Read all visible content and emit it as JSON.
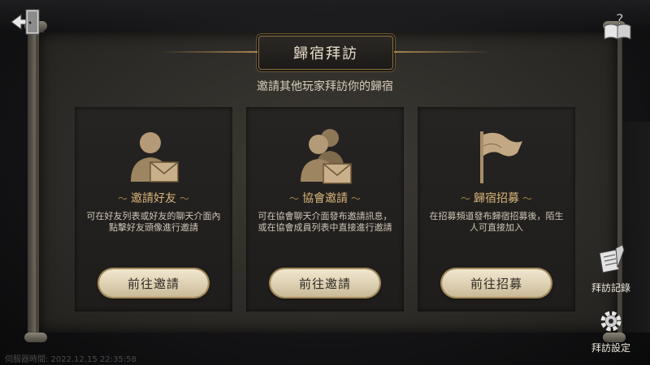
{
  "title": "歸宿拜訪",
  "subtitle": "邀請其他玩家拜訪你的歸宿",
  "cards": [
    {
      "icon": "person-letter-icon",
      "title": "邀請好友",
      "description": "可在好友列表或好友的聊天介面內點擊好友頭像進行邀請",
      "button": "前往邀請"
    },
    {
      "icon": "group-letter-icon",
      "title": "協會邀請",
      "description": "可在協會聊天介面發布邀請訊息，或在協會成員列表中直接進行邀請",
      "button": "前往邀請"
    },
    {
      "icon": "flag-icon",
      "title": "歸宿招募",
      "description": "在招募頻道發布歸宿招募後，陌生人可直接加入",
      "button": "前往招募"
    }
  ],
  "side": {
    "record_label": "拜訪記錄",
    "settings_label": "拜訪設定"
  },
  "background": {
    "server_time": "伺服器時間: 2022.12.15 22:35:58"
  },
  "colors": {
    "accent_gold": "#d9b57a",
    "button_cream": "#e8dcc1",
    "panel_dark": "#262422"
  }
}
